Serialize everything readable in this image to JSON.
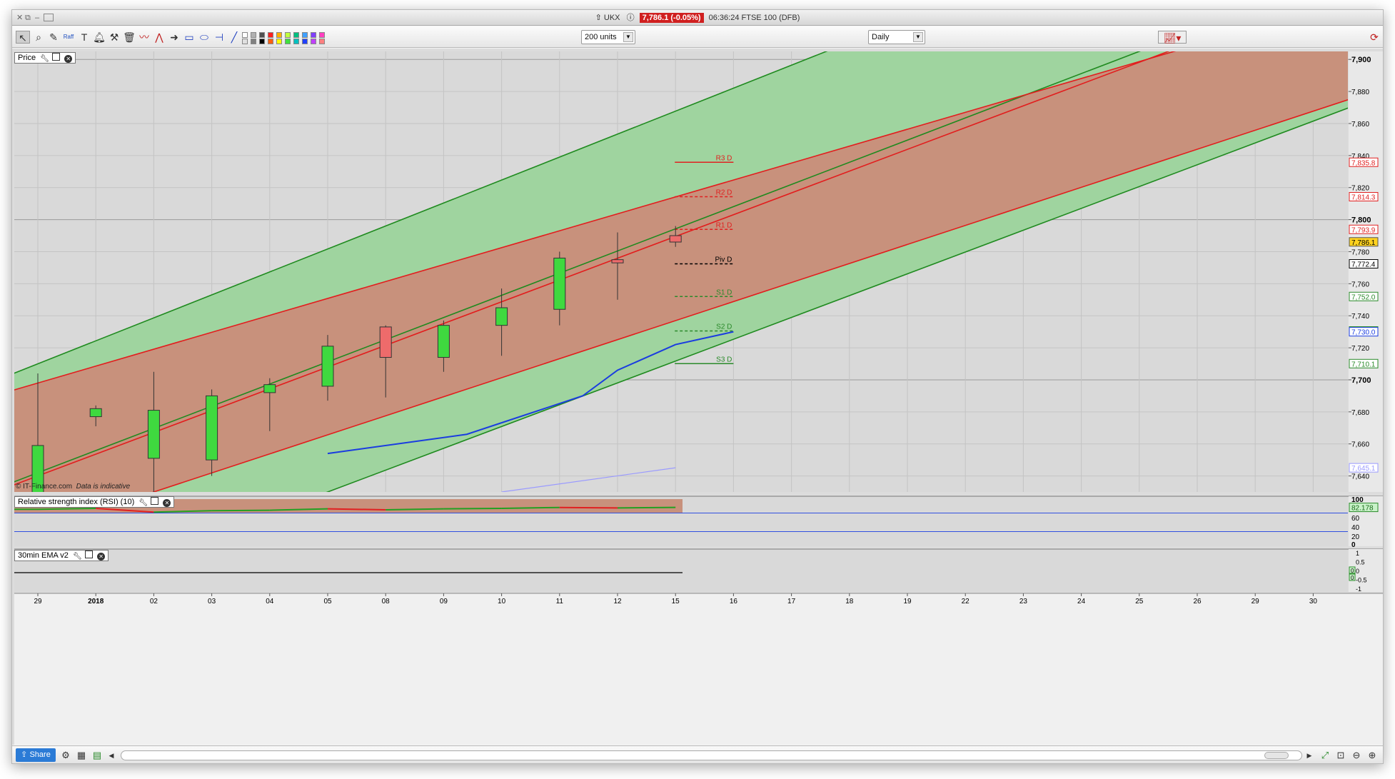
{
  "window": {
    "title_symbol": "UKX",
    "price_badge": "7,786.1 (-0.05%)",
    "clock_label": "06:36:24 FTSE 100 (DFB)"
  },
  "toolbar": {
    "units_select": "200 units",
    "period_select": "Daily",
    "tools": [
      "pointer-icon",
      "magnifier-icon",
      "chart-edit-icon",
      "raff-channel-icon",
      "text-icon",
      "alert-bell-icon",
      "tools-icon",
      "trash-icon",
      "indicator-icon",
      "fan-icon",
      "arrow-icon",
      "rectangle-icon",
      "ellipse-icon",
      "hline-icon",
      "trendline-icon"
    ],
    "swatch_colors": [
      "#ffffff",
      "#e0e0e0",
      "#b0b0b0",
      "#808080",
      "#505050",
      "#000000",
      "#ff2020",
      "#ff6010",
      "#ffb000",
      "#ffff00",
      "#c0ff40",
      "#40e040",
      "#00c080",
      "#00c0c0",
      "#40a0ff",
      "#2040ff",
      "#8040ff",
      "#c040ff",
      "#ff40c0",
      "#ff8080"
    ]
  },
  "price_panel": {
    "label": "Price",
    "watermark_source": "© IT-Finance.com",
    "watermark_note": "Data is indicative",
    "pivots": [
      {
        "name": "R3 D",
        "value": "7,835.8",
        "color": "#e02020"
      },
      {
        "name": "R2 D",
        "value": "7,814.3",
        "color": "#e02020"
      },
      {
        "name": "R1 D",
        "value": "7,793.9",
        "color": "#e02020"
      },
      {
        "name": "Piv D",
        "value": "7,772.4",
        "color": "#000000"
      },
      {
        "name": "S1 D",
        "value": "7,752.0",
        "color": "#2a8a2a"
      },
      {
        "name": "S2 D",
        "value": "7,730.5",
        "color": "#2a8a2a"
      },
      {
        "name": "S3 D",
        "value": "7,710.1",
        "color": "#2a8a2a"
      }
    ],
    "current_price_tag": "7,786.1",
    "ma_tag": "7,730.0",
    "extra_tag": "7,645.1"
  },
  "rsi_panel": {
    "label": "Relative strength index (RSI) (10)",
    "value_tag": "82.178",
    "ticks": [
      "100",
      "60",
      "40",
      "20",
      "0"
    ]
  },
  "ema_panel": {
    "label": "30min EMA v2",
    "ticks": [
      "1",
      "0.5",
      "0",
      "-0.5",
      "-1"
    ],
    "value_tags": [
      "0",
      "0"
    ]
  },
  "chart_data": {
    "type": "candlestick",
    "title": "",
    "ylim": [
      7630,
      7905
    ],
    "y_ticks": [
      "7,900",
      "7,880",
      "7,860",
      "7,840",
      "7,820",
      "7,800",
      "7,780",
      "7,760",
      "7,740",
      "7,720",
      "7,700",
      "7,680",
      "7,660",
      "7,640"
    ],
    "x_ticks": [
      "29",
      "2018",
      "02",
      "03",
      "04",
      "05",
      "08",
      "09",
      "10",
      "11",
      "12",
      "15",
      "16",
      "17",
      "18",
      "19",
      "22",
      "23",
      "24",
      "25",
      "26",
      "29",
      "30"
    ],
    "candles": [
      {
        "date": "29",
        "open": 7620,
        "high": 7704,
        "low": 7600,
        "close": 7659
      },
      {
        "date": "2018",
        "open": 7677,
        "high": 7684,
        "low": 7671,
        "close": 7682
      },
      {
        "date": "02",
        "open": 7651,
        "high": 7705,
        "low": 7620,
        "close": 7681
      },
      {
        "date": "03",
        "open": 7650,
        "high": 7694,
        "low": 7640,
        "close": 7690
      },
      {
        "date": "04",
        "open": 7692,
        "high": 7701,
        "low": 7668,
        "close": 7697
      },
      {
        "date": "05",
        "open": 7696,
        "high": 7728,
        "low": 7687,
        "close": 7721
      },
      {
        "date": "08",
        "open": 7733,
        "high": 7734,
        "low": 7689,
        "close": 7714
      },
      {
        "date": "09",
        "open": 7714,
        "high": 7737,
        "low": 7705,
        "close": 7734
      },
      {
        "date": "10",
        "open": 7734,
        "high": 7757,
        "low": 7715,
        "close": 7745
      },
      {
        "date": "11",
        "open": 7744,
        "high": 7780,
        "low": 7734,
        "close": 7776
      },
      {
        "date": "12",
        "open": 7775,
        "high": 7792,
        "low": 7750,
        "close": 7773
      },
      {
        "date": "15",
        "open": 7790,
        "high": 7796,
        "low": 7783,
        "close": 7786
      }
    ],
    "ma_line": [
      [
        5,
        7654
      ],
      [
        7.4,
        7666
      ],
      [
        9.4,
        7690
      ],
      [
        10,
        7706
      ],
      [
        11,
        7722
      ],
      [
        12,
        7730
      ]
    ],
    "rsi_values": [
      78,
      80,
      72,
      75,
      76,
      79,
      77,
      79,
      80,
      82,
      81,
      82.178
    ],
    "green_channel": {
      "upper": [
        [
          0,
          7710
        ],
        [
          13.6,
          7905
        ]
      ],
      "mid": [
        [
          0,
          7642
        ],
        [
          19,
          7905
        ]
      ],
      "lower": [
        [
          5,
          7630
        ],
        [
          22.7,
          7871
        ]
      ]
    },
    "red_channel": {
      "upper": [
        [
          0,
          7698
        ],
        [
          19.6,
          7905
        ]
      ],
      "mid": [
        [
          0,
          7640
        ],
        [
          19.5,
          7905
        ]
      ],
      "lower": [
        [
          2,
          7630
        ],
        [
          22.7,
          7876
        ]
      ]
    }
  },
  "bottombar": {
    "share_label": "Share"
  }
}
